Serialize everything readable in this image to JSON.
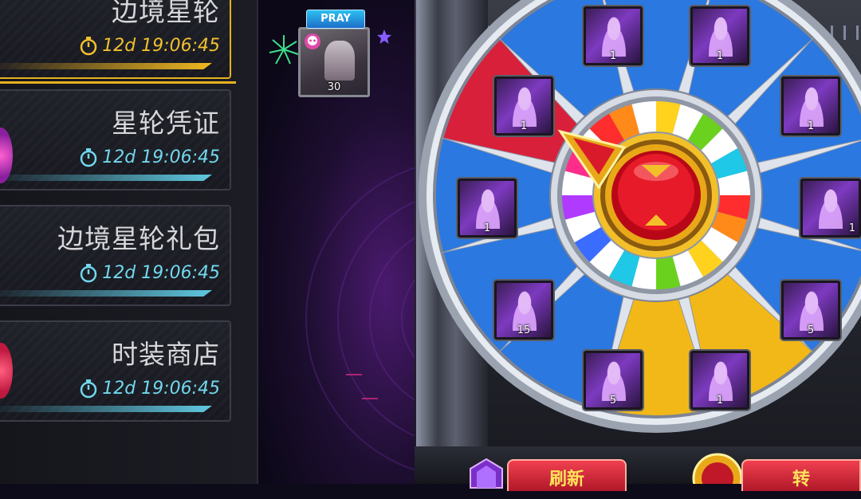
{
  "menu": [
    {
      "title": "边境星轮",
      "timer": "12d 19:06:45",
      "active": true
    },
    {
      "title": "星轮凭证",
      "timer": "12d 19:06:45",
      "active": false
    },
    {
      "title": "边境星轮礼包",
      "timer": "12d 19:06:45",
      "active": false
    },
    {
      "title": "时装商店",
      "timer": "12d 19:06:45",
      "active": false
    }
  ],
  "pray": {
    "banner": "PRAY",
    "count": "30"
  },
  "wheel": {
    "segment_colors": [
      "#2a78e0",
      "#2a78e0",
      "#2a78e0",
      "#2a78e0",
      "#2a78e0",
      "#f2b818",
      "#f2b818",
      "#2a78e0",
      "#2a78e0",
      "#2a78e0",
      "#d8203a",
      "#2a78e0"
    ],
    "items": [
      {
        "count": "1"
      },
      {
        "count": "1"
      },
      {
        "count": "1"
      },
      {
        "count": "1"
      },
      {
        "count": "1"
      },
      {
        "count": "5"
      },
      {
        "count": "1"
      },
      {
        "count": "5"
      },
      {
        "count": "15"
      },
      {
        "count": "1"
      },
      {
        "count": "1"
      }
    ]
  },
  "buttons": {
    "refresh": "刷新",
    "spin": "转"
  }
}
